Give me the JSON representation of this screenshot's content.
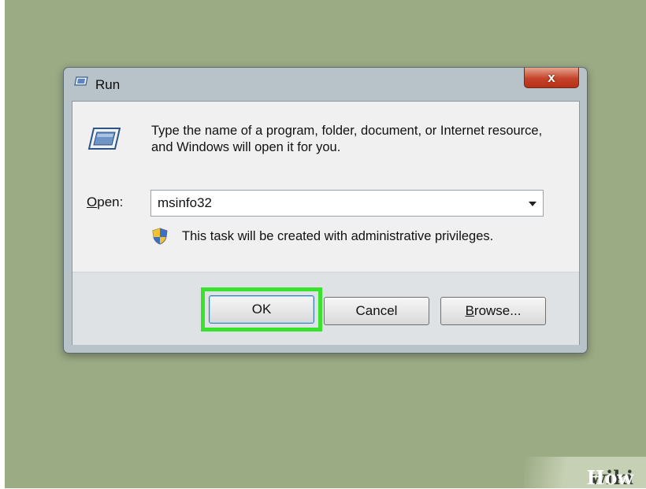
{
  "window": {
    "title": "Run",
    "close_label": "x",
    "title_icon": "run-icon"
  },
  "dialog": {
    "icon": "run-icon",
    "description": "Type the name of a program, folder, document, or Internet resource, and Windows will open it for you.",
    "open_label_mnemonic": "O",
    "open_label_rest": "pen:",
    "open_value": "msinfo32",
    "admin_icon": "uac-shield-icon",
    "admin_note": "This task will be created with administrative privileges."
  },
  "buttons": {
    "ok": "OK",
    "cancel": "Cancel",
    "browse_mnemonic": "B",
    "browse_rest": "rowse..."
  },
  "highlight_color": "#38e22d",
  "watermark": {
    "wiki": "wiki",
    "how": "How"
  }
}
